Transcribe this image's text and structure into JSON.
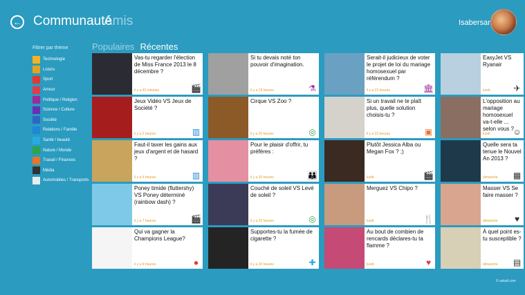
{
  "header": {
    "back_icon": "arrow-left-icon",
    "title": "Communauté",
    "alt_title": "Amis",
    "user_name": "Isabersam"
  },
  "sidebar": {
    "title": "Filtrer par thème",
    "items": [
      {
        "label": "Technologie",
        "color": "#f6b223"
      },
      {
        "label": "Loisirs",
        "color": "#e8a21a"
      },
      {
        "label": "Sport",
        "color": "#e2392c"
      },
      {
        "label": "Amour",
        "color": "#e1394e"
      },
      {
        "label": "Politique / Religion",
        "color": "#9e2a9a"
      },
      {
        "label": "Science / Culture",
        "color": "#6a2fb5"
      },
      {
        "label": "Société",
        "color": "#2f66c4"
      },
      {
        "label": "Relations / Famille",
        "color": "#1f87d6"
      },
      {
        "label": "Santé / beauté",
        "color": "#29a9e2"
      },
      {
        "label": "Nature / Monde",
        "color": "#2fa34a"
      },
      {
        "label": "Travail / Finances",
        "color": "#e9742a"
      },
      {
        "label": "Média",
        "color": "#333333"
      },
      {
        "label": "Automobiles / Transports",
        "color": "#e9ecef"
      }
    ]
  },
  "tabs": [
    {
      "label": "Populaires",
      "active": false
    },
    {
      "label": "Récentes",
      "active": true
    }
  ],
  "cards": [
    {
      "text": "Vas-tu regarder l'élection de Miss France 2013 le 8 décembre ?",
      "time": "il y a 42 minutes",
      "icon": "clapper-icon",
      "thumb": "#2b2b33",
      "badge_color": "#333"
    },
    {
      "text": "Si tu devais noté ton pouvoir d'imagination.",
      "time": "il y a 19 heures",
      "icon": "flask-icon",
      "thumb": "#a0a0a0",
      "badge_color": "#9e2a9a"
    },
    {
      "text": "Serait-il judicieux de voter le projet de loi du mariage homosexuel par référendum ?",
      "time": "il y a 23 heures",
      "icon": "building-icon",
      "thumb": "#6aa1c2",
      "badge_color": "#9e2a9a"
    },
    {
      "text": "EasyJet VS Ryanair",
      "time": "lundi",
      "icon": "plane-icon",
      "thumb": "#b9d0e0",
      "badge_color": "#333"
    },
    {
      "text": "Jeux Vidéo VS Jeux de Société ?",
      "time": "il y a 2 heures",
      "icon": "city-icon",
      "thumb": "#a61d1d",
      "badge_color": "#1f87d6"
    },
    {
      "text": "Cirque VS Zoo ?",
      "time": "il y a 20 heures",
      "icon": "globe-icon",
      "thumb": "#8c5a26",
      "badge_color": "#2fa34a"
    },
    {
      "text": "Si un travail ne te plaît plus, quelle solution choisis-tu ?",
      "time": "il y a 23 heures",
      "icon": "briefcase-icon",
      "thumb": "#d5d2cc",
      "badge_color": "#e9742a"
    },
    {
      "text": "L'opposition au mariage homosexuel va-t-elle ... selon vous ?",
      "time": "lundi",
      "icon": "people-icon",
      "thumb": "#8b6e62",
      "badge_color": "#333"
    },
    {
      "text": "Faut-il taxer les gains aux jeux d'argent et de hasard ?",
      "time": "il y a 4 heures",
      "icon": "city-icon",
      "thumb": "#c9a45d",
      "badge_color": "#1f87d6"
    },
    {
      "text": "Pour le plaisir d'offrir, tu préfères :",
      "time": "il y a 20 heures",
      "icon": "family-icon",
      "thumb": "#e58fa2",
      "badge_color": "#1f87d6"
    },
    {
      "text": "Plutôt Jessica Alba ou Megan Fox ? ;)",
      "time": "lundi",
      "icon": "clapper-icon",
      "thumb": "#3a2a22",
      "badge_color": "#333"
    },
    {
      "text": "Quelle sera ta tenue le Nouvel An 2013 ?",
      "time": "dimanche",
      "icon": "calendar-icon",
      "thumb": "#1e3a4a",
      "badge_color": "#333"
    },
    {
      "text": "Poney timide (fluttershy) VS Poney déterminé (rainbow dash) ?",
      "time": "il y a 7 heures",
      "icon": "clapper-icon",
      "thumb": "#7fc9e8",
      "badge_color": "#333"
    },
    {
      "text": "Couché de soleil VS Levé de soleil ?",
      "time": "il y a 20 heures",
      "icon": "globe-icon",
      "thumb": "#3b3b58",
      "badge_color": "#2fa34a"
    },
    {
      "text": "Merguez VS Chipo ?",
      "time": "lundi",
      "icon": "fork-knife-icon",
      "thumb": "#c89a7e",
      "badge_color": "#e8a21a"
    },
    {
      "text": "Masser VS Se faire masser ?",
      "time": "dimanche",
      "icon": "heart-icon",
      "thumb": "#d9a58f",
      "badge_color": "#333"
    },
    {
      "text": "Qui va gagner la Champions League?",
      "time": "il y a 9 heures",
      "icon": "ball-icon",
      "thumb": "#f5f5f5",
      "badge_color": "#e2392c"
    },
    {
      "text": "Supportes-tu la fumée de cigarette ?",
      "time": "il y a 20 heures",
      "icon": "cross-icon",
      "thumb": "#242424",
      "badge_color": "#29a9e2"
    },
    {
      "text": "Au bout de combien de rencards déclares-tu ta flamme ?",
      "time": "lundi",
      "icon": "heart-icon",
      "thumb": "#c54a76",
      "badge_color": "#e1394e"
    },
    {
      "text": "À quel point es-tu susceptible ?",
      "time": "dimanche",
      "icon": "diploma-icon",
      "thumb": "#d8cfb7",
      "badge_color": "#333"
    }
  ],
  "copyright": "© askall.com"
}
